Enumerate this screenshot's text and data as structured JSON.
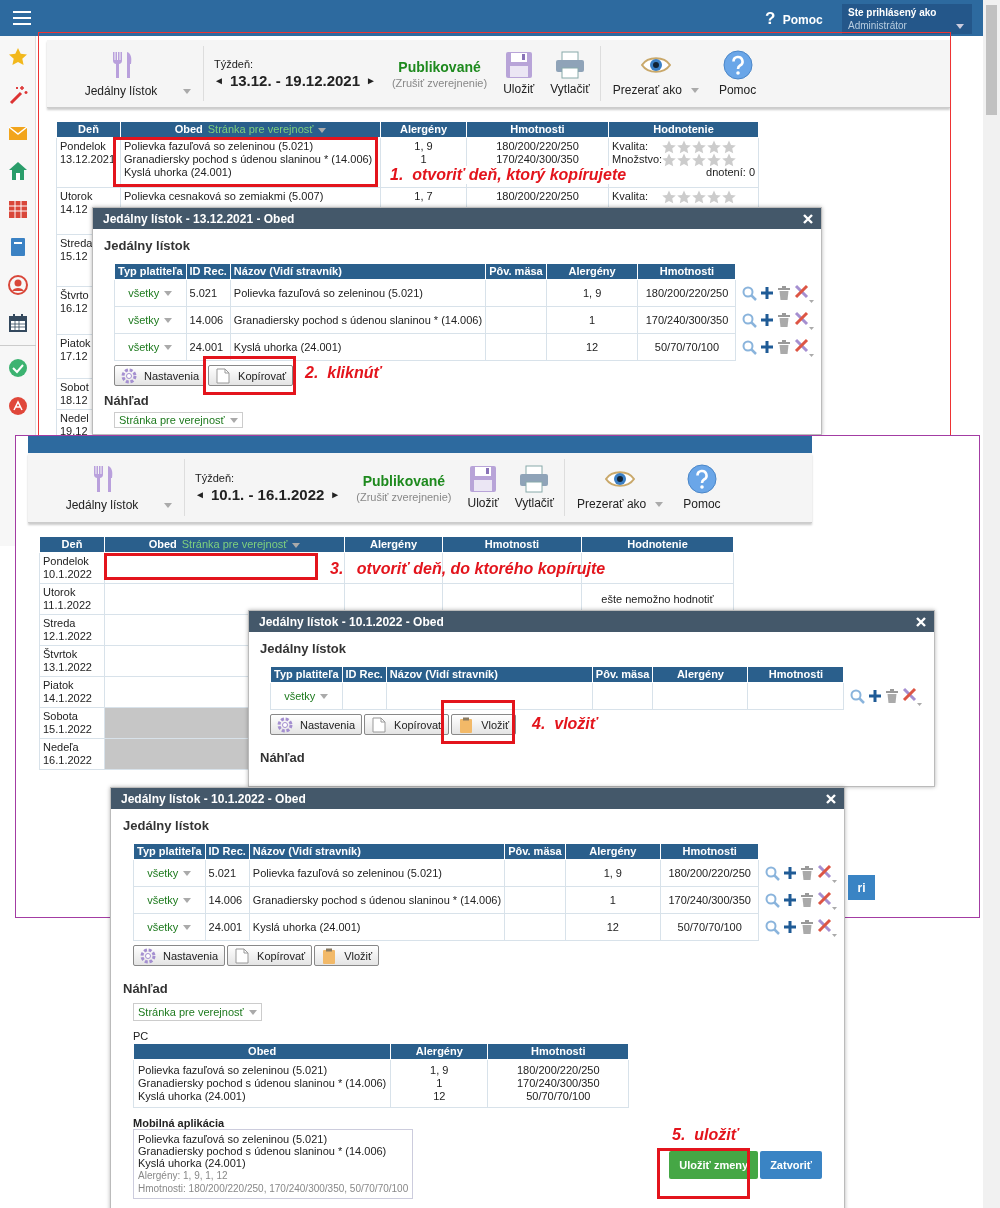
{
  "top_bar": {
    "help_mark": "?",
    "help": "Pomoc",
    "login_label": "Ste prihlásený ako",
    "login_user": "Administrátor"
  },
  "screens": [
    {
      "toolbar": {
        "menu": "Jedálny lístok",
        "week_label": "Týždeň:",
        "prev": "◄",
        "week": "13.12. - 19.12.2021",
        "next": "►",
        "status": "Publikované",
        "unpublish": "(Zrušiť zverejnenie)",
        "save": "Uložiť",
        "print": "Vytlačiť",
        "view_as": "Prezerať ako",
        "help": "Pomoc"
      },
      "table": {
        "columns": [
          "Deň",
          "Obed",
          "Alergény",
          "Hmotnosti",
          "Hodnotenie"
        ],
        "filter": "Stránka pre verejnosť",
        "rows": [
          {
            "day": "Pondelok",
            "date": "13.12.2021",
            "meals": [
              "Polievka fazuľová so zeleninou (5.021)",
              "Granadiersky pochod s údenou slaninou * (14.006)",
              "Kyslá uhorka (24.001)"
            ],
            "allergens": [
              "1, 9",
              "1"
            ],
            "weights": [
              "180/200/220/250",
              "170/240/300/350"
            ],
            "ratings": [
              {
                "label": "Kvalita:",
                "stars": 0
              },
              {
                "label": "Množstvo:",
                "stars": 0
              }
            ],
            "rating_note": "dnotení: 0"
          },
          {
            "day": "Utorok",
            "date": "14.12",
            "meals": [
              "Polievka cesnaková so zemiakmi (5.007)"
            ],
            "allergens": [
              "1, 7"
            ],
            "weights": [
              "180/200/220/250"
            ],
            "ratings": [
              {
                "label": "Kvalita:",
                "stars": 0
              }
            ]
          },
          {
            "day": "Streda",
            "date": "15.12"
          },
          {
            "day": "Štvrto",
            "date": "16.12"
          },
          {
            "day": "Piatok",
            "date": "17.12"
          },
          {
            "day": "Sobot",
            "date": "18.12"
          },
          {
            "day": "Nedel",
            "date": "19.12"
          }
        ]
      }
    },
    {
      "toolbar": {
        "menu": "Jedálny lístok",
        "week_label": "Týždeň:",
        "prev": "◄",
        "week": "10.1. - 16.1.2022",
        "next": "►",
        "status": "Publikované",
        "unpublish": "(Zrušiť zverejnenie)",
        "save": "Uložiť",
        "print": "Vytlačiť",
        "view_as": "Prezerať ako",
        "help": "Pomoc"
      },
      "table": {
        "columns": [
          "Deň",
          "Obed",
          "Alergény",
          "Hmotnosti",
          "Hodnotenie"
        ],
        "filter": "Stránka pre verejnosť",
        "rows": [
          {
            "day": "Pondelok",
            "date": "10.1.2022",
            "disabled": false
          },
          {
            "day": "Utorok",
            "date": "11.1.2022",
            "disabled": false,
            "rating_note": "ešte nemožno hodnotiť"
          },
          {
            "day": "Streda",
            "date": "12.1.2022",
            "disabled": false
          },
          {
            "day": "Štvrtok",
            "date": "13.1.2022",
            "disabled": false
          },
          {
            "day": "Piatok",
            "date": "14.1.2022",
            "disabled": false
          },
          {
            "day": "Sobota",
            "date": "15.1.2022",
            "disabled": true
          },
          {
            "day": "Nedeľa",
            "date": "16.1.2022",
            "disabled": true
          }
        ]
      }
    }
  ],
  "dialogs": [
    {
      "title": "Jedálny lístok - 13.12.2021 - Obed",
      "section": "Jedálny lístok",
      "columns": [
        "Typ platiteľa",
        "ID Rec.",
        "Názov (Vidí stravník)",
        "Pôv. mäsa",
        "Alergény",
        "Hmotnosti"
      ],
      "rows": [
        {
          "payer": "všetky",
          "id": "5.021",
          "name": "Polievka fazuľová so zeleninou (5.021)",
          "allergens": "1, 9",
          "weights": "180/200/220/250"
        },
        {
          "payer": "všetky",
          "id": "14.006",
          "name": "Granadiersky pochod s údenou slaninou * (14.006)",
          "allergens": "1",
          "weights": "170/240/300/350"
        },
        {
          "payer": "všetky",
          "id": "24.001",
          "name": "Kyslá uhorka (24.001)",
          "allergens": "12",
          "weights": "50/70/70/100"
        }
      ],
      "buttons": [
        {
          "kind": "settings",
          "label": "Nastavenia"
        },
        {
          "kind": "copy",
          "label": "Kopírovať"
        }
      ],
      "preview_label": "Náhľad",
      "preview_select": "Stránka pre verejnosť"
    },
    {
      "title": "Jedálny lístok - 10.1.2022 - Obed",
      "section": "Jedálny lístok",
      "columns": [
        "Typ platiteľa",
        "ID Rec.",
        "Názov (Vidí stravník)",
        "Pôv. mäsa",
        "Alergény",
        "Hmotnosti"
      ],
      "rows": [
        {
          "payer": "všetky"
        }
      ],
      "buttons": [
        {
          "kind": "settings",
          "label": "Nastavenia"
        },
        {
          "kind": "copy",
          "label": "Kopírovať"
        },
        {
          "kind": "paste",
          "label": "Vložiť"
        }
      ],
      "preview_label": "Náhľad"
    },
    {
      "title": "Jedálny lístok - 10.1.2022 - Obed",
      "section": "Jedálny lístok",
      "columns": [
        "Typ platiteľa",
        "ID Rec.",
        "Názov (Vidí stravník)",
        "Pôv. mäsa",
        "Alergény",
        "Hmotnosti"
      ],
      "rows": [
        {
          "payer": "všetky",
          "id": "5.021",
          "name": "Polievka fazuľová so zeleninou (5.021)",
          "allergens": "1, 9",
          "weights": "180/200/220/250"
        },
        {
          "payer": "všetky",
          "id": "14.006",
          "name": "Granadiersky pochod s údenou slaninou * (14.006)",
          "allergens": "1",
          "weights": "170/240/300/350"
        },
        {
          "payer": "všetky",
          "id": "24.001",
          "name": "Kyslá uhorka (24.001)",
          "allergens": "12",
          "weights": "50/70/70/100"
        }
      ],
      "buttons": [
        {
          "kind": "settings",
          "label": "Nastavenia"
        },
        {
          "kind": "copy",
          "label": "Kopírovať"
        },
        {
          "kind": "paste",
          "label": "Vložiť"
        }
      ],
      "preview_label": "Náhľad",
      "preview_select": "Stránka pre verejnosť",
      "pc_label": "PC",
      "pc_table": {
        "columns": [
          "Obed",
          "Alergény",
          "Hmotnosti"
        ],
        "meals": [
          "Polievka fazuľová so zeleninou (5.021)",
          "Granadiersky pochod s údenou slaninou * (14.006)",
          "Kyslá uhorka (24.001)"
        ],
        "allergens": [
          "1, 9",
          "1",
          "12"
        ],
        "weights": [
          "180/200/220/250",
          "170/240/300/350",
          "50/70/70/100"
        ]
      },
      "mobile_label": "Mobilná aplikácia",
      "mobile": {
        "lines": [
          "Polievka fazuľová so zeleninou (5.021)",
          "Granadiersky pochod s údenou slaninou * (14.006)",
          "Kyslá uhorka (24.001)"
        ],
        "allergens": "Alergény: 1, 9, 1, 12",
        "weights": "Hmotnosti: 180/200/220/250, 170/240/300/350, 50/70/70/100"
      },
      "actions": [
        {
          "kind": "primary",
          "label": "Uložiť zmeny"
        },
        {
          "kind": "secondary",
          "label": "Zatvoriť"
        }
      ]
    }
  ],
  "stray_button": {
    "label": "ri"
  },
  "annotations": [
    {
      "text": "1.  otvoriť deň, ktorý kopírujete"
    },
    {
      "text": "2.  kliknúť"
    },
    {
      "text": "3.   otvoriť deň, do ktorého kopírujte"
    },
    {
      "text": "4.  vložiť"
    },
    {
      "text": "5.  uložiť"
    }
  ]
}
